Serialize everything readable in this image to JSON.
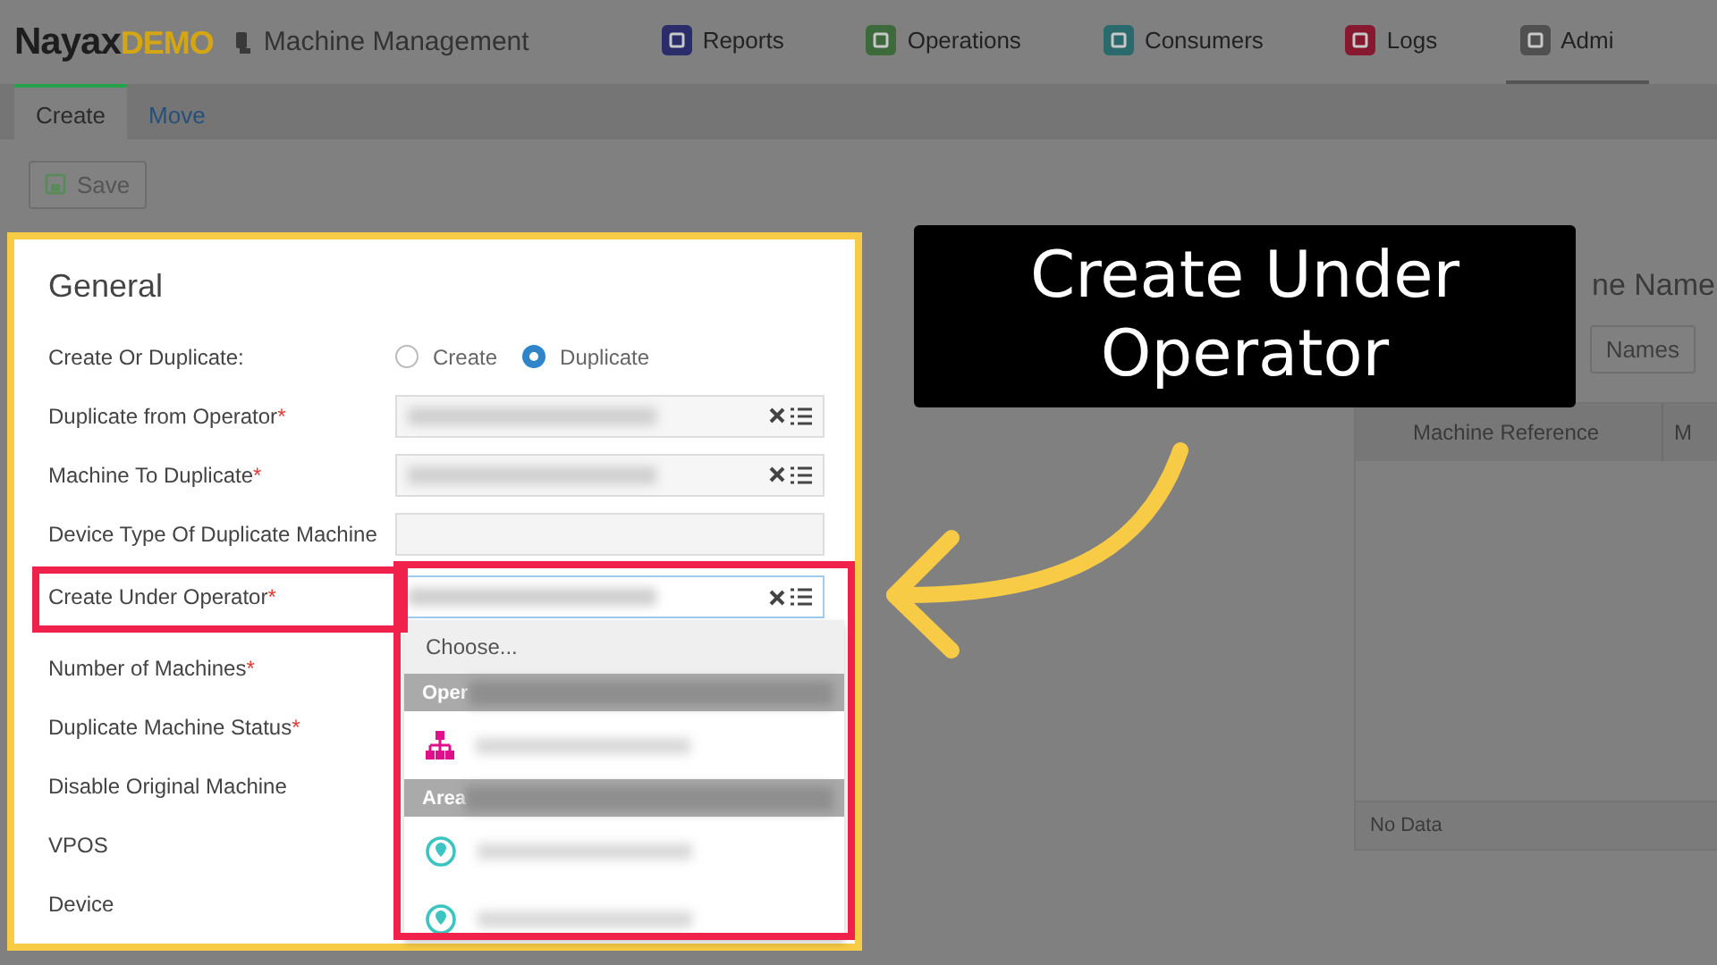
{
  "header": {
    "logo": {
      "name": "Nayax",
      "suffix": "DEMO"
    },
    "title": "Machine Management",
    "nav": [
      {
        "label": "Reports",
        "color": "#2b2d6b",
        "selected": false
      },
      {
        "label": "Operations",
        "color": "#3d6a3a",
        "selected": false
      },
      {
        "label": "Consumers",
        "color": "#2a6a6c",
        "selected": false
      },
      {
        "label": "Logs",
        "color": "#86182f",
        "selected": false
      },
      {
        "label": "Admi",
        "color": "#505050",
        "selected": true
      }
    ]
  },
  "subtabs": [
    {
      "label": "Create",
      "selected": true
    },
    {
      "label": "Move",
      "selected": false
    }
  ],
  "save_button": "Save",
  "general": {
    "title": "General",
    "fields": [
      {
        "label": "Create Or Duplicate:",
        "kind": "radio",
        "options": [
          {
            "label": "Create",
            "selected": false
          },
          {
            "label": "Duplicate",
            "selected": true
          }
        ]
      },
      {
        "label": "Duplicate from Operator",
        "mark": "*",
        "kind": "select"
      },
      {
        "label": "Machine To Duplicate",
        "mark": "*",
        "kind": "select"
      },
      {
        "label": "Device Type Of Duplicate Machine",
        "kind": "text"
      },
      {
        "label": "Create Under Operator",
        "mark": "*",
        "kind": "select",
        "focused": true
      },
      {
        "label": "Number of Machines",
        "mark": "*",
        "kind": "covered"
      },
      {
        "label": "Duplicate Machine Status",
        "mark": "*",
        "kind": "covered"
      },
      {
        "label": "Disable Original Machine",
        "kind": "covered"
      },
      {
        "label": "VPOS",
        "kind": "covered"
      },
      {
        "label": "Device",
        "kind": "covered"
      }
    ],
    "dropdown": {
      "first_option": {
        "label": "Choose...",
        "selected": true
      },
      "groups": [
        {
          "label": "Oper",
          "items": [
            {
              "kind": "operator",
              "selected": false
            }
          ]
        },
        {
          "label": "Area",
          "items": [
            {
              "kind": "area",
              "selected": false
            },
            {
              "kind": "area",
              "selected": false
            }
          ]
        }
      ]
    }
  },
  "callout": {
    "text": "Create Under Operator"
  },
  "right_panel": {
    "heading": "ne Name",
    "button": "Names",
    "table": {
      "columns": [
        "Machine Reference",
        "M"
      ],
      "footer": "No Data"
    }
  }
}
